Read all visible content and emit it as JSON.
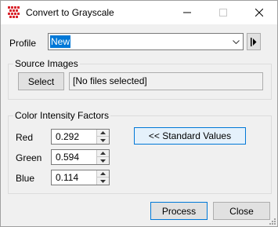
{
  "window": {
    "title": "Convert to Grayscale",
    "icon": "app-grid-icon",
    "controls": [
      "minimize-icon",
      "maximize-icon",
      "close-icon"
    ]
  },
  "profile": {
    "label": "Profile",
    "value": "New",
    "dropdown_icon": "chevron-down-icon",
    "action_icon": "play-bar-icon"
  },
  "source_images": {
    "title": "Source Images",
    "select_label": "Select",
    "files_text": "[No files selected]"
  },
  "color_factors": {
    "title": "Color Intensity Factors",
    "red": {
      "label": "Red",
      "value": "0.292"
    },
    "green": {
      "label": "Green",
      "value": "0.594"
    },
    "blue": {
      "label": "Blue",
      "value": "0.114"
    },
    "standard_values_label": "<< Standard Values"
  },
  "footer": {
    "process_label": "Process",
    "close_label": "Close"
  },
  "colors": {
    "accent": "#0078d7",
    "icon_red": "#d9272e",
    "window_bg": "#f0f0f0"
  }
}
